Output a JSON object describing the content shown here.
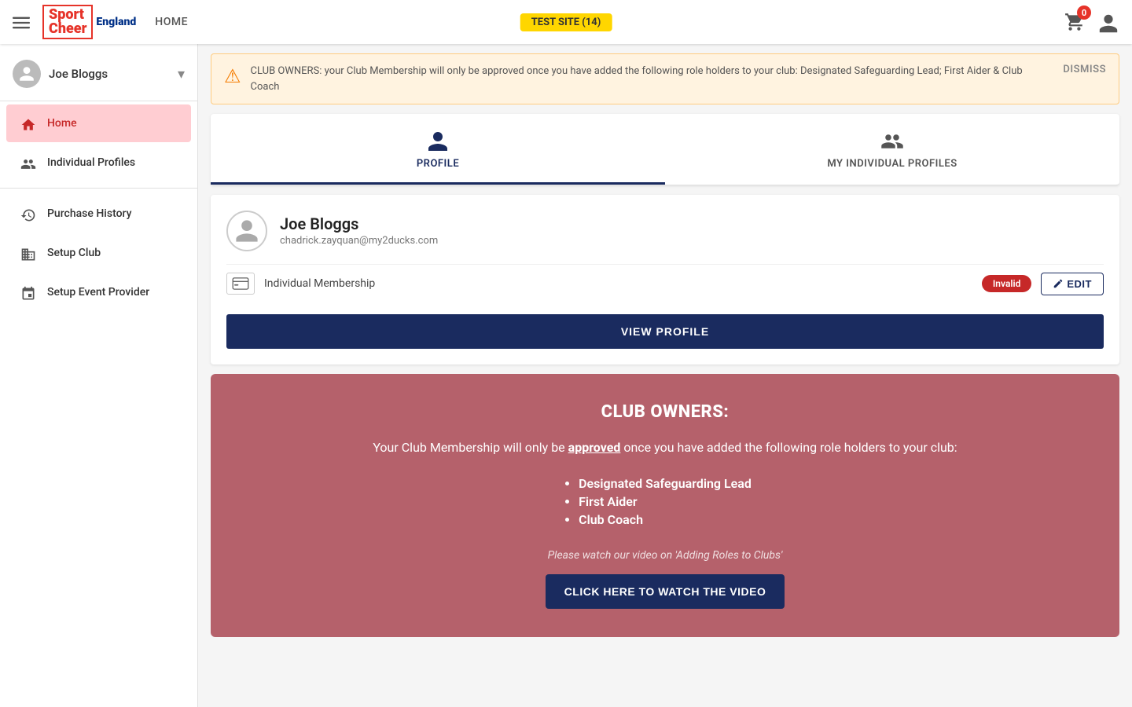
{
  "topnav": {
    "menu_icon": "☰",
    "logo_sport": "Sport",
    "logo_cheer": "Cheer",
    "logo_england": "England",
    "home_label": "HOME",
    "test_badge": "TEST SITE (14)",
    "cart_count": "0"
  },
  "sidebar": {
    "user_name": "Joe Bloggs",
    "chevron": "▾",
    "items": [
      {
        "id": "home",
        "label": "Home",
        "icon": "home",
        "active": true
      },
      {
        "id": "individual-profiles",
        "label": "Individual Profiles",
        "icon": "people",
        "active": false
      },
      {
        "id": "purchase-history",
        "label": "Purchase History",
        "icon": "history",
        "active": false
      },
      {
        "id": "setup-club",
        "label": "Setup Club",
        "icon": "business",
        "active": false
      },
      {
        "id": "setup-event-provider",
        "label": "Setup Event Provider",
        "icon": "event",
        "active": false
      }
    ]
  },
  "alert": {
    "icon": "⚠",
    "text": "CLUB OWNERS: your Club Membership will only be approved once you have added the following role holders to your club: Designated Safeguarding Lead; First Aider & Club Coach",
    "dismiss_label": "DISMISS"
  },
  "profile_tabs": [
    {
      "id": "profile",
      "label": "PROFILE",
      "active": true
    },
    {
      "id": "my-individual-profiles",
      "label": "MY INDIVIDUAL PROFILES",
      "active": false
    }
  ],
  "profile_card": {
    "name": "Joe Bloggs",
    "email": "chadrick.zayquan@my2ducks.com",
    "membership_label": "Individual Membership",
    "membership_status": "Invalid",
    "edit_label": "EDIT",
    "view_profile_label": "VIEW PROFILE"
  },
  "club_owners_section": {
    "title": "CLUB OWNERS:",
    "intro": "Your Club Membership will only be",
    "intro_link": "approved",
    "intro_end": "once you have added the following role holders to your club:",
    "role_holders": [
      "Designated Safeguarding Lead",
      "First Aider",
      "Club Coach"
    ],
    "video_text": "Please watch our video on 'Adding Roles to Clubs'",
    "watch_btn_label": "CLICK HERE TO WATCH THE VIDEO"
  }
}
